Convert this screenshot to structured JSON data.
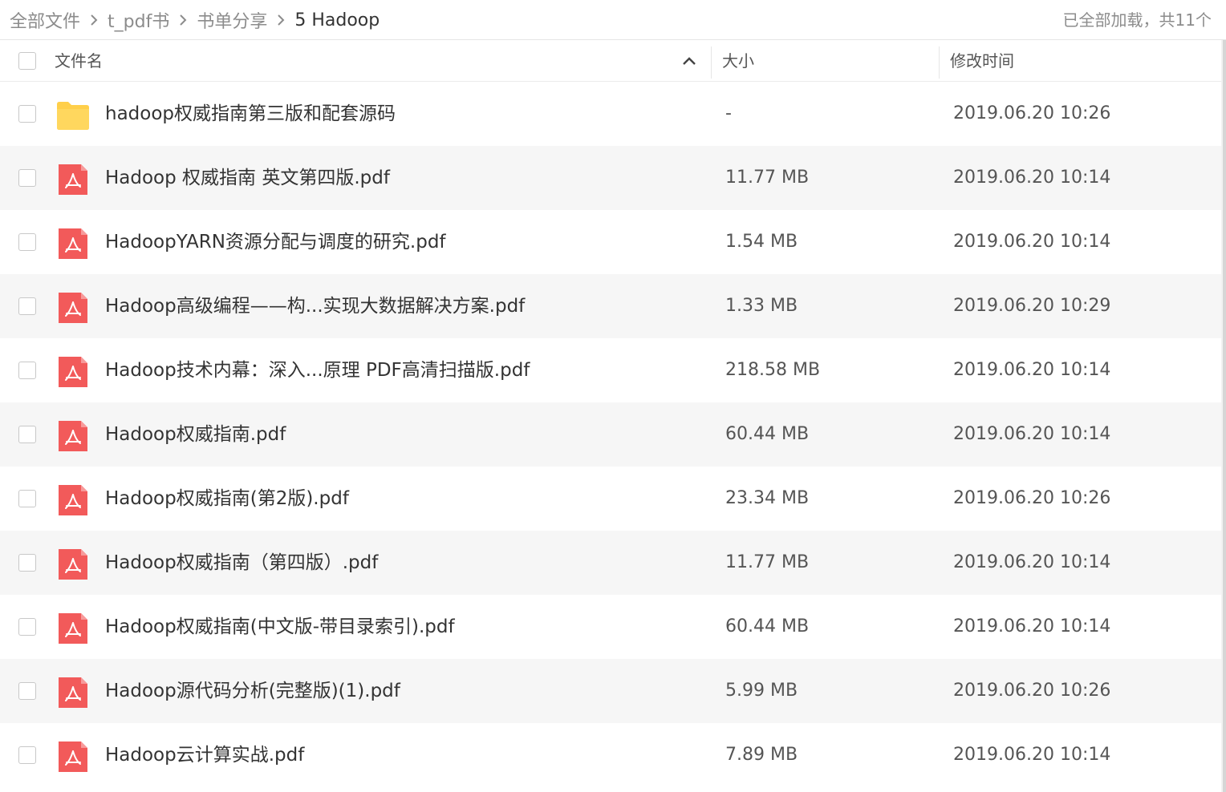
{
  "breadcrumb": {
    "items": [
      {
        "label": "全部文件",
        "current": false
      },
      {
        "label": "t_pdf书",
        "current": false
      },
      {
        "label": "书单分享",
        "current": false
      },
      {
        "label": "5 Hadoop",
        "current": true
      }
    ],
    "separator_icon": "chevron-right-icon"
  },
  "status": {
    "loaded_text": "已全部加载，共11个"
  },
  "table": {
    "columns": {
      "name": "文件名",
      "size": "大小",
      "modified": "修改时间"
    },
    "sort": {
      "column": "name",
      "direction": "ascending",
      "icon": "chevron-up-icon"
    },
    "rows": [
      {
        "type": "folder",
        "icon": "folder-icon",
        "name": "hadoop权威指南第三版和配套源码",
        "size": "-",
        "modified": "2019.06.20 10:26"
      },
      {
        "type": "pdf",
        "icon": "pdf-file-icon",
        "name": "Hadoop 权威指南 英文第四版.pdf",
        "size": "11.77 MB",
        "modified": "2019.06.20 10:14"
      },
      {
        "type": "pdf",
        "icon": "pdf-file-icon",
        "name": "HadoopYARN资源分配与调度的研究.pdf",
        "size": "1.54 MB",
        "modified": "2019.06.20 10:14"
      },
      {
        "type": "pdf",
        "icon": "pdf-file-icon",
        "name": "Hadoop高级编程——构...实现大数据解决方案.pdf",
        "size": "1.33 MB",
        "modified": "2019.06.20 10:29"
      },
      {
        "type": "pdf",
        "icon": "pdf-file-icon",
        "name": "Hadoop技术内幕：深入...原理 PDF高清扫描版.pdf",
        "size": "218.58 MB",
        "modified": "2019.06.20 10:14"
      },
      {
        "type": "pdf",
        "icon": "pdf-file-icon",
        "name": "Hadoop权威指南.pdf",
        "size": "60.44 MB",
        "modified": "2019.06.20 10:14"
      },
      {
        "type": "pdf",
        "icon": "pdf-file-icon",
        "name": "Hadoop权威指南(第2版).pdf",
        "size": "23.34 MB",
        "modified": "2019.06.20 10:26"
      },
      {
        "type": "pdf",
        "icon": "pdf-file-icon",
        "name": "Hadoop权威指南（第四版）.pdf",
        "size": "11.77 MB",
        "modified": "2019.06.20 10:14"
      },
      {
        "type": "pdf",
        "icon": "pdf-file-icon",
        "name": "Hadoop权威指南(中文版-带目录索引).pdf",
        "size": "60.44 MB",
        "modified": "2019.06.20 10:14"
      },
      {
        "type": "pdf",
        "icon": "pdf-file-icon",
        "name": "Hadoop源代码分析(完整版)(1).pdf",
        "size": "5.99 MB",
        "modified": "2019.06.20 10:26"
      },
      {
        "type": "pdf",
        "icon": "pdf-file-icon",
        "name": "Hadoop云计算实战.pdf",
        "size": "7.89 MB",
        "modified": "2019.06.20 10:14"
      }
    ]
  },
  "colors": {
    "folder": "#ffcf4a",
    "pdf": "#f25a5a",
    "alt_row": "#f6f6f6"
  }
}
